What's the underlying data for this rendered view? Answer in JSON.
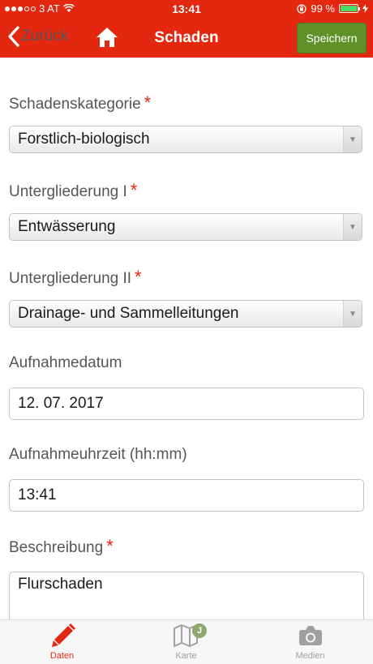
{
  "status_bar": {
    "carrier": "3 AT",
    "time": "13:41",
    "battery": "99 %",
    "battery_level": 0.99
  },
  "nav": {
    "back_label": "Zurück",
    "title": "Schaden",
    "save_label": "Speichern"
  },
  "form": {
    "required_mark": "*",
    "category": {
      "label": "Schadenskategorie",
      "value": "Forstlich-biologisch"
    },
    "sub1": {
      "label": "Untergliederung I",
      "value": "Entwässerung"
    },
    "sub2": {
      "label": "Untergliederung II",
      "value": "Drainage- und Sammelleitungen"
    },
    "date": {
      "label": "Aufnahmedatum",
      "value": "12. 07. 2017"
    },
    "time": {
      "label": "Aufnahmeuhrzeit (hh:mm)",
      "value": "13:41"
    },
    "description": {
      "label": "Beschreibung",
      "value": "Flurschaden"
    }
  },
  "tabs": {
    "daten": "Daten",
    "karte": "Karte",
    "karte_badge": "J",
    "medien": "Medien"
  },
  "colors": {
    "brand": "#e4280f",
    "save": "#5f9128",
    "tab_active": "#e4280f",
    "tab_inactive": "#a0a0a0"
  },
  "icons": {
    "back": "chevron-left-icon",
    "home": "home-icon",
    "daten": "pencil-icon",
    "karte": "map-icon",
    "medien": "camera-icon"
  }
}
